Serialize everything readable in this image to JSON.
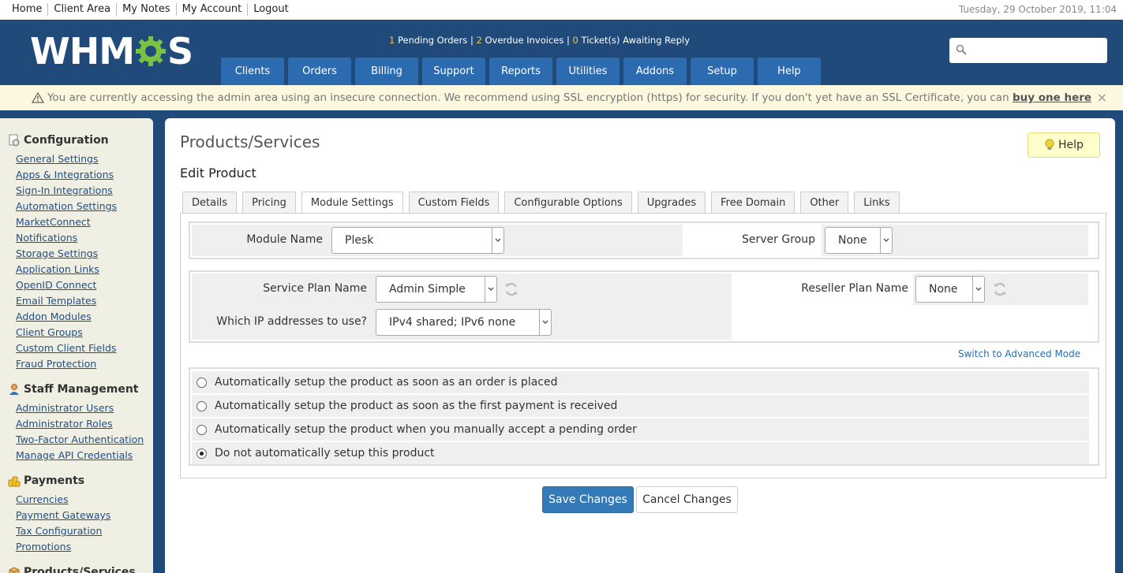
{
  "topbar": {
    "links": [
      "Home",
      "Client Area",
      "My Notes",
      "My Account",
      "Logout"
    ],
    "datetime": "Tuesday, 29 October 2019, 11:04"
  },
  "header": {
    "logo_left": "WHM",
    "logo_right": "S",
    "alerts": {
      "pending_count": "1",
      "pending_label": " Pending Orders",
      "overdue_count": "2",
      "overdue_label": " Overdue Invoices",
      "tickets_count": "0",
      "tickets_label": " Ticket(s) Awaiting Reply",
      "separator": " | "
    },
    "nav": [
      "Clients",
      "Orders",
      "Billing",
      "Support",
      "Reports",
      "Utilities",
      "Addons",
      "Setup",
      "Help"
    ],
    "search_placeholder": ""
  },
  "warning": {
    "text": "You are currently accessing the admin area using an insecure connection. We recommend using SSL encryption (https) for security. If you don't yet have an SSL Certificate, you can ",
    "link": "buy one here",
    "close": "×"
  },
  "sidebar": {
    "sections": [
      {
        "title": "Configuration",
        "icon": "gear-page-icon",
        "items": [
          "General Settings",
          "Apps & Integrations",
          "Sign-In Integrations",
          "Automation Settings",
          "MarketConnect",
          "Notifications",
          "Storage Settings",
          "Application Links",
          "OpenID Connect",
          "Email Templates",
          "Addon Modules",
          "Client Groups",
          "Custom Client Fields",
          "Fraud Protection"
        ]
      },
      {
        "title": "Staff Management",
        "icon": "user-icon",
        "items": [
          "Administrator Users",
          "Administrator Roles",
          "Two-Factor Authentication",
          "Manage API Credentials"
        ]
      },
      {
        "title": "Payments",
        "icon": "coins-icon",
        "items": [
          "Currencies",
          "Payment Gateways",
          "Tax Configuration",
          "Promotions"
        ]
      },
      {
        "title": "Products/Services",
        "icon": "box-icon",
        "items": []
      }
    ]
  },
  "main": {
    "title": "Products/Services",
    "help_label": "Help",
    "subtitle": "Edit Product",
    "tabs": [
      "Details",
      "Pricing",
      "Module Settings",
      "Custom Fields",
      "Configurable Options",
      "Upgrades",
      "Free Domain",
      "Other",
      "Links"
    ],
    "active_tab": "Module Settings",
    "module": {
      "module_name_label": "Module Name",
      "module_name_value": "Plesk",
      "server_group_label": "Server Group",
      "server_group_value": "None"
    },
    "plan": {
      "service_plan_label": "Service Plan Name",
      "service_plan_value": "Admin Simple",
      "reseller_plan_label": "Reseller Plan Name",
      "reseller_plan_value": "None",
      "ip_label": "Which IP addresses to use?",
      "ip_value": "IPv4 shared; IPv6 none"
    },
    "advanced_link": "Switch to Advanced Mode",
    "setup_options": [
      {
        "label": "Automatically setup the product as soon as an order is placed",
        "selected": false
      },
      {
        "label": "Automatically setup the product as soon as the first payment is received",
        "selected": false
      },
      {
        "label": "Automatically setup the product when you manually accept a pending order",
        "selected": false
      },
      {
        "label": "Do not automatically setup this product",
        "selected": true
      }
    ],
    "save_label": "Save Changes",
    "cancel_label": "Cancel Changes"
  }
}
